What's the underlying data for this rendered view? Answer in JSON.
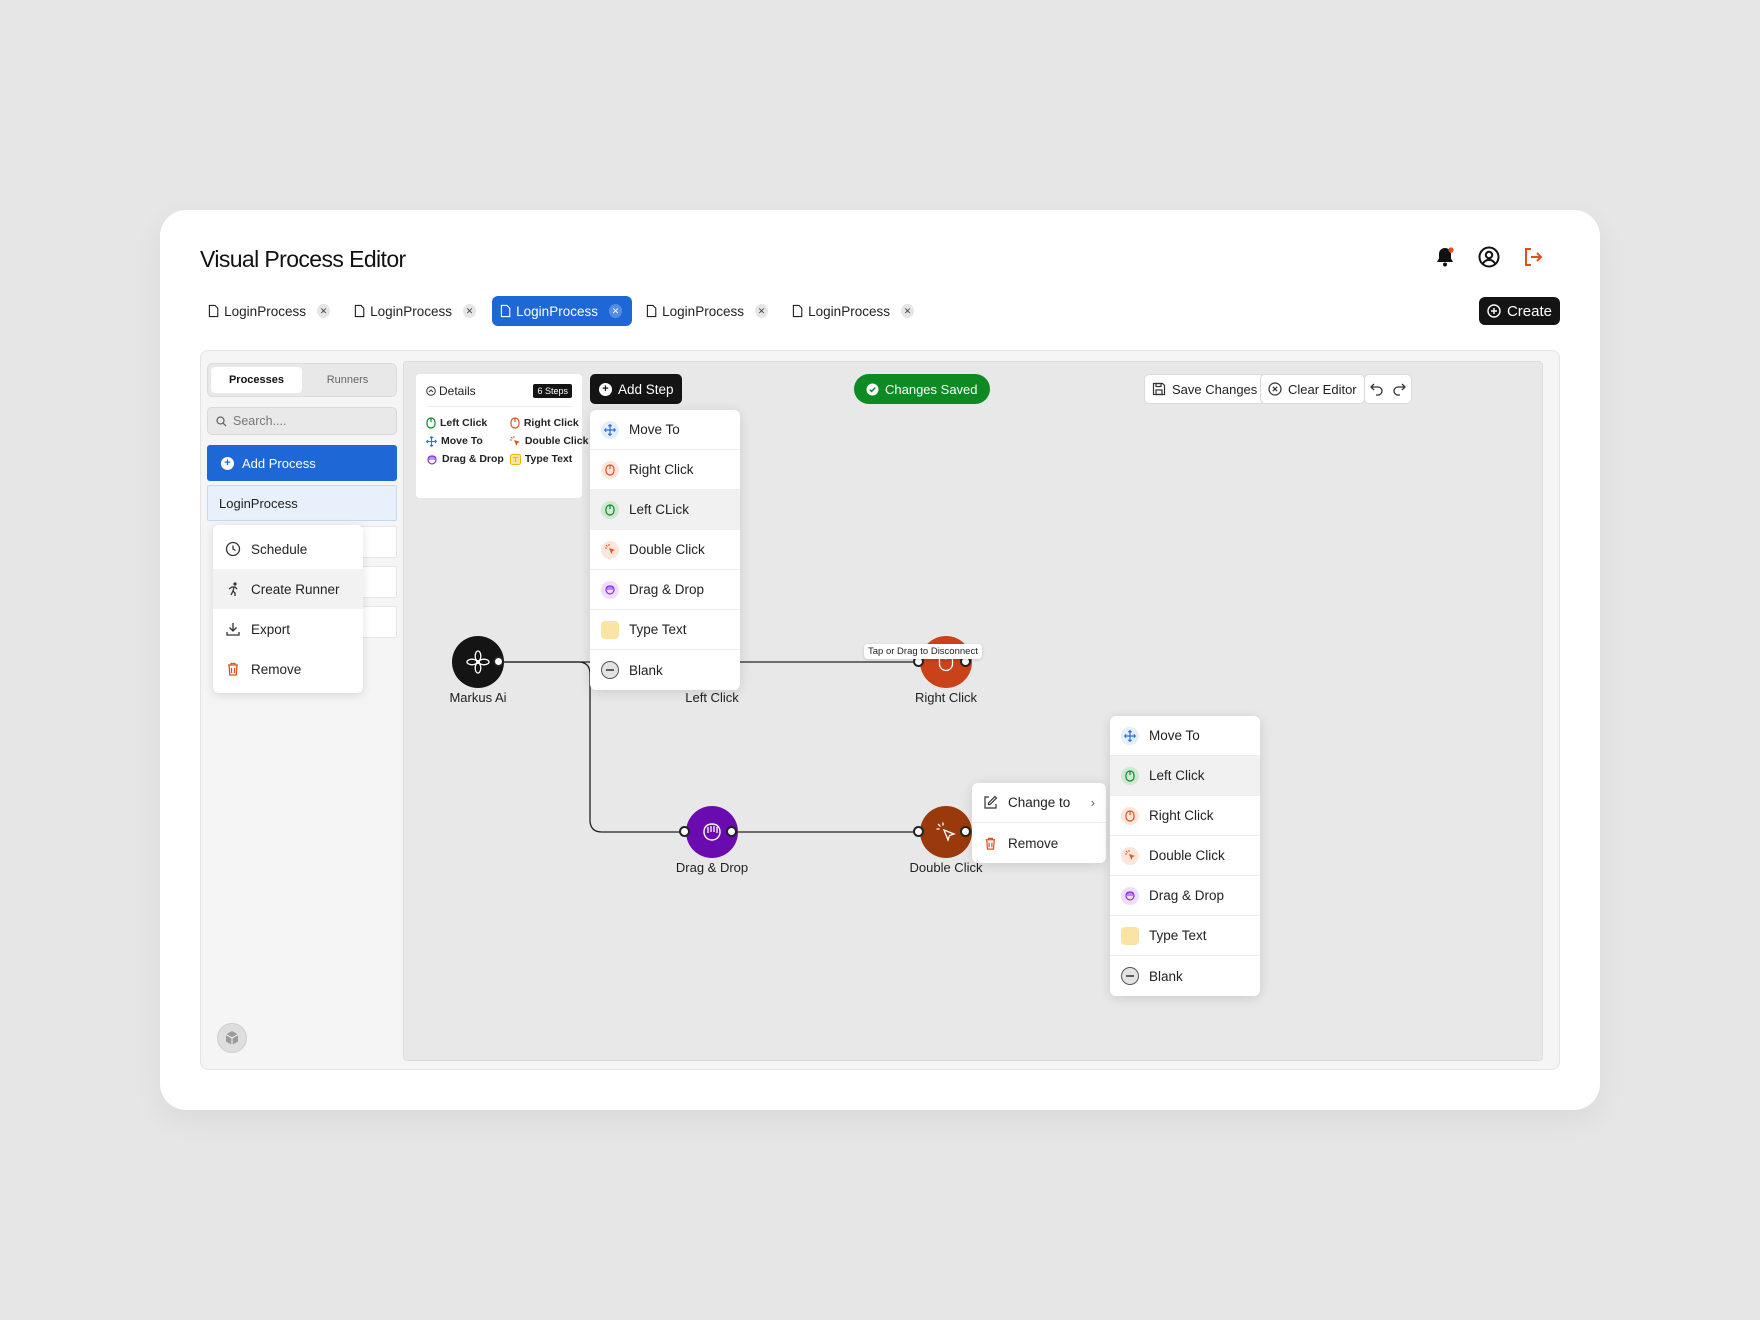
{
  "app": {
    "title": "Visual Process Editor"
  },
  "header": {
    "icons": [
      "bell-icon",
      "user-circle-icon",
      "logout-icon"
    ],
    "accent": "#e0501b"
  },
  "tabs": [
    {
      "label": "LoginProcess",
      "active": false
    },
    {
      "label": "LoginProcess",
      "active": false
    },
    {
      "label": "LoginProcess",
      "active": true
    },
    {
      "label": "LoginProcess",
      "active": false
    },
    {
      "label": "LoginProcess",
      "active": false
    }
  ],
  "create_label": "Create",
  "sidebar": {
    "tabs": [
      "Processes",
      "Runners"
    ],
    "active_tab": "Processes",
    "search_placeholder": "Search....",
    "add_process_label": "Add Process",
    "process_item": "LoginProcess",
    "context_menu": [
      {
        "label": "Schedule",
        "icon": "clock-icon"
      },
      {
        "label": "Create Runner",
        "icon": "runner-icon"
      },
      {
        "label": "Export",
        "icon": "download-icon"
      },
      {
        "label": "Remove",
        "icon": "trash-icon"
      }
    ]
  },
  "details": {
    "title": "Details",
    "badge": "6 Steps",
    "legend": [
      "Left Click",
      "Right Click",
      "Move To",
      "Double Click",
      "Drag & Drop",
      "Type Text"
    ]
  },
  "toolbar": {
    "add_step": "Add Step",
    "status": "Changes Saved",
    "save": "Save Changes",
    "clear": "Clear Editor"
  },
  "step_menu": [
    "Move To",
    "Right Click",
    "Left CLick",
    "Double Click",
    "Drag & Drop",
    "Type Text",
    "Blank"
  ],
  "change_menu": [
    "Move To",
    "Left Click",
    "Right Click",
    "Double Click",
    "Drag & Drop",
    "Type Text",
    "Blank"
  ],
  "node_context": {
    "change_to": "Change to",
    "remove": "Remove"
  },
  "nodes": {
    "markus": "Markus Ai",
    "left": "Left Click",
    "right": "Right Click",
    "drag": "Drag & Drop",
    "double": "Double Click"
  },
  "tooltip": "Tap or Drag to Disconnect",
  "colors": {
    "primary": "#1d67d6",
    "success": "#0e8a23",
    "left_click": "#0b5a1b",
    "right_click": "#c9421a",
    "drag_drop": "#6a0bb0",
    "double_click": "#9a3a0c",
    "move_to": "#2a72d8",
    "type_text": "#f4b400"
  }
}
